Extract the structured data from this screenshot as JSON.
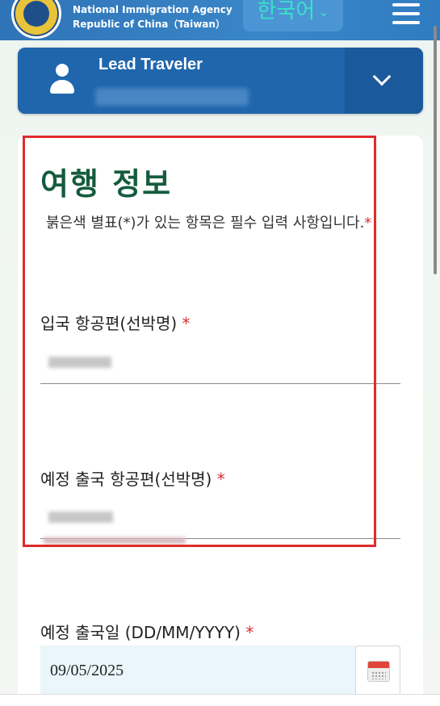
{
  "header": {
    "agency_line1": "National Immigration Agency",
    "agency_line2": "Republic of China（Taiwan）",
    "language": "한국어",
    "menu_icon": "hamburger-icon"
  },
  "traveler": {
    "title": "Lead Traveler",
    "icon": "person-icon",
    "toggle_icon": "chevron-down-icon"
  },
  "form": {
    "title": "여행 정보",
    "required_note": "붉은색 별표(*)가 있는 항목은 필수 입력 사항입니다.",
    "required_mark": "*",
    "fields": {
      "arrival_flight": {
        "label": "입국 항공편(선박명)"
      },
      "departure_flight": {
        "label": "예정 출국 항공편(선박명)"
      },
      "departure_date": {
        "label": "예정 출국일 (DD/MM/YYYY)",
        "value": "09/05/2025"
      }
    }
  },
  "colors": {
    "header_blue": "#2f74b7",
    "traveler_blue": "#1f66ad",
    "title_green": "#145c3e",
    "language_text": "#39e3c8",
    "required_red": "#d63131",
    "highlight_red": "#e02a2a"
  }
}
